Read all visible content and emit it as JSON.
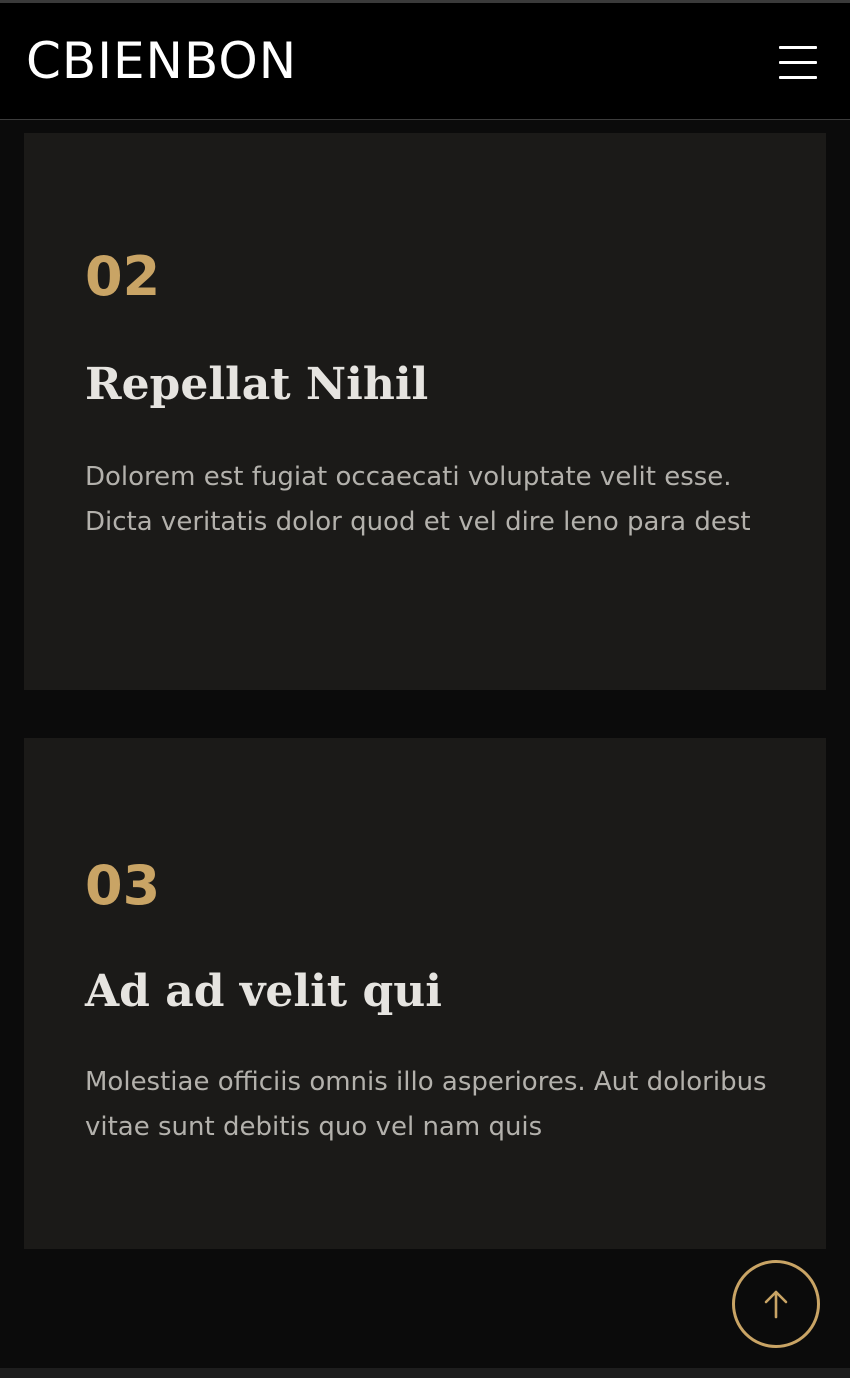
{
  "header": {
    "logo": "CBIENBON",
    "menu_icon": "hamburger-menu-icon"
  },
  "features": [
    {
      "number": "02",
      "title": "Repellat Nihil",
      "description": "Dolorem est fugiat occaecati voluptate velit esse. Dicta veritatis dolor quod et vel dire leno para dest"
    },
    {
      "number": "03",
      "title": "Ad ad velit qui",
      "description": "Molestiae officiis omnis illo asperiores. Aut doloribus vitae sunt debitis quo vel nam quis"
    }
  ],
  "scroll_top": {
    "icon": "arrow-up-icon"
  },
  "colors": {
    "accent": "#c9a465",
    "page_background": "#0b0b0b",
    "card_background": "#1b1a18",
    "header_background": "#000000"
  }
}
